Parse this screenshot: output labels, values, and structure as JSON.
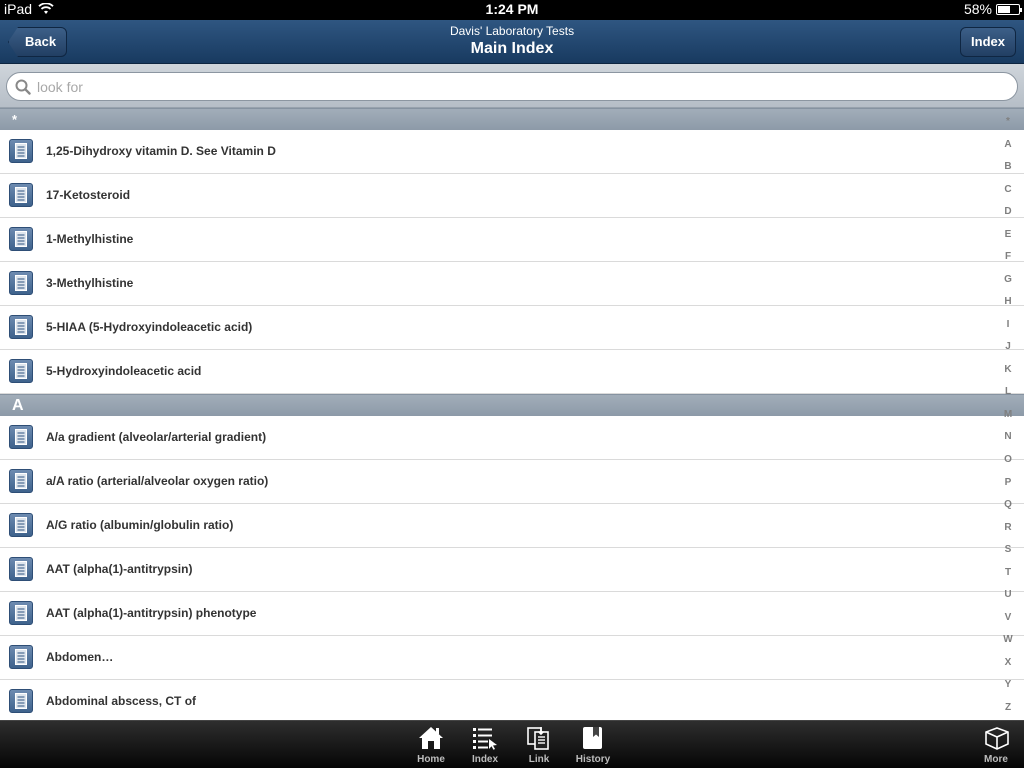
{
  "status": {
    "device": "iPad",
    "time": "1:24 PM",
    "battery": "58%",
    "battery_level": 0.58
  },
  "nav": {
    "back_label": "Back",
    "subtitle": "Davis' Laboratory Tests",
    "title": "Main Index",
    "index_label": "Index"
  },
  "search": {
    "placeholder": "look for",
    "value": ""
  },
  "sections": [
    {
      "header": "*",
      "items": [
        "1,25-Dihydroxy vitamin D. See Vitamin D",
        "17-Ketosteroid",
        "1-Methylhistine",
        "3-Methylhistine",
        "5-HIAA (5-Hydroxyindoleacetic acid)",
        "5-Hydroxyindoleacetic acid"
      ]
    },
    {
      "header": "A",
      "items": [
        "A/a gradient (alveolar/arterial gradient)",
        "a/A ratio (arterial/alveolar oxygen ratio)",
        "A/G ratio (albumin/globulin ratio)",
        "AAT (alpha(1)-antitrypsin)",
        "AAT (alpha(1)-antitrypsin) phenotype",
        "Abdomen…",
        "Abdominal abscess, CT of"
      ]
    }
  ],
  "alphabet": [
    "*",
    "A",
    "B",
    "C",
    "D",
    "E",
    "F",
    "G",
    "H",
    "I",
    "J",
    "K",
    "L",
    "M",
    "N",
    "O",
    "P",
    "Q",
    "R",
    "S",
    "T",
    "U",
    "V",
    "W",
    "X",
    "Y",
    "Z"
  ],
  "tabbar": {
    "tabs": [
      {
        "label": "Home",
        "icon": "home-icon"
      },
      {
        "label": "Index",
        "icon": "index-list-icon"
      },
      {
        "label": "Link",
        "icon": "link-doc-icon"
      },
      {
        "label": "History",
        "icon": "bookmark-book-icon"
      }
    ],
    "more_label": "More",
    "more_icon": "box-icon"
  },
  "colors": {
    "nav": "#1f4470",
    "section": "#97a3b1",
    "doc_icon": "#4f7099"
  }
}
